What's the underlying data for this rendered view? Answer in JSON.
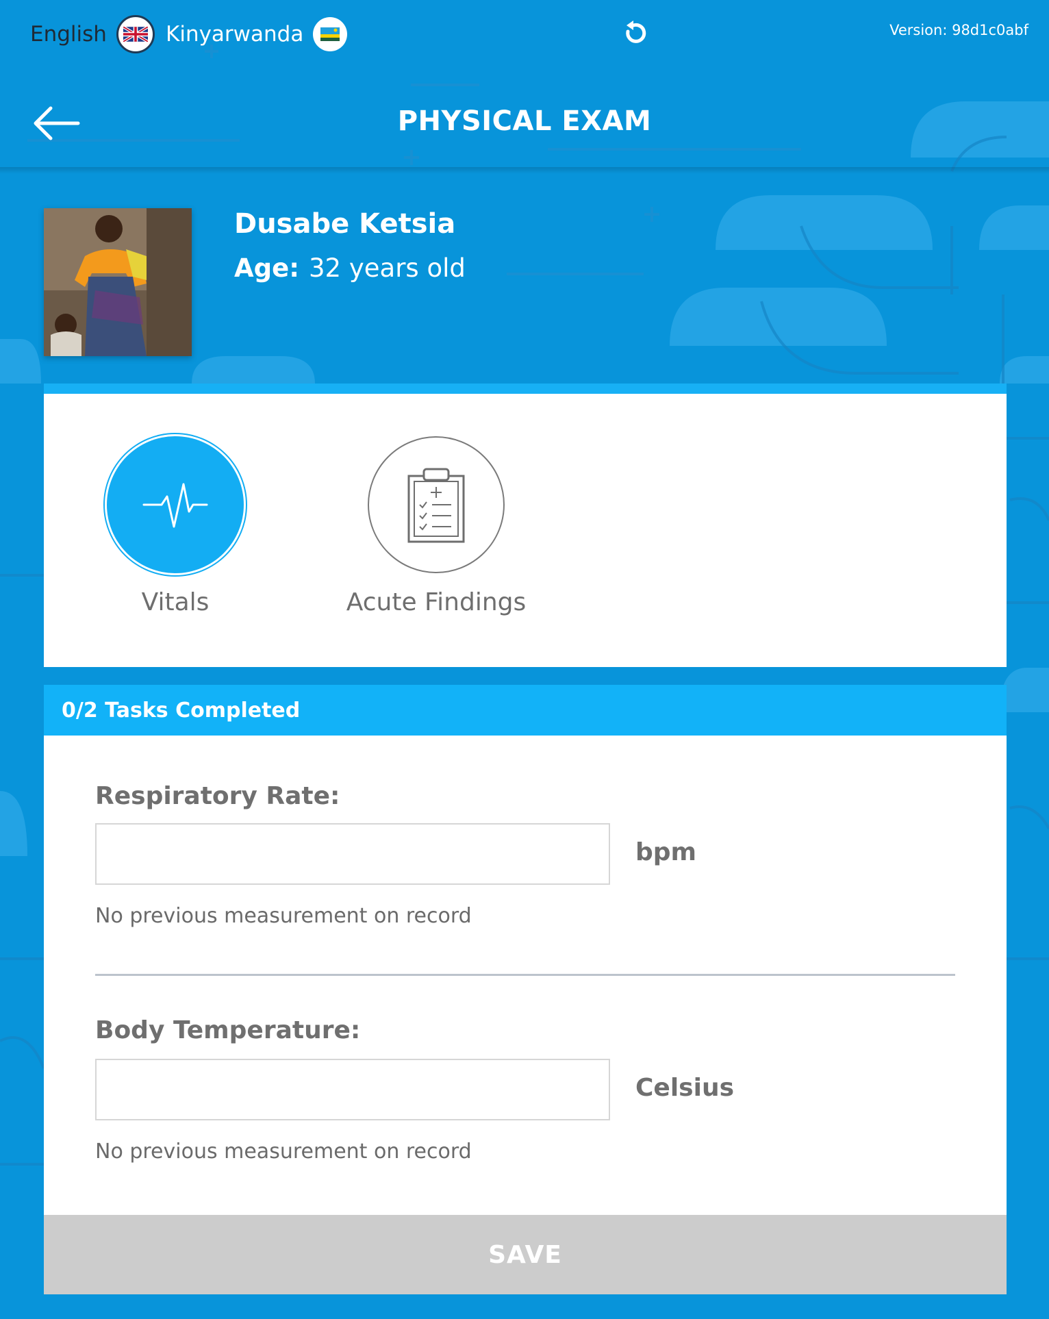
{
  "languages": [
    {
      "label": "English",
      "icon": "uk-flag-icon"
    },
    {
      "label": "Kinyarwanda",
      "icon": "rwanda-flag-icon"
    }
  ],
  "version": "Version: 98d1c0abf",
  "header": {
    "title": "PHYSICAL EXAM",
    "back_icon": "back-arrow-icon",
    "refresh_icon": "refresh-icon"
  },
  "patient": {
    "name": "Dusabe Ketsia",
    "age_label": "Age:",
    "age_value": "32 years old"
  },
  "tabs": [
    {
      "label": "Vitals",
      "icon": "heartbeat-icon",
      "active": true
    },
    {
      "label": "Acute Findings",
      "icon": "clipboard-checklist-icon",
      "active": false
    }
  ],
  "form": {
    "progress": "0/2 Tasks Completed",
    "fields": [
      {
        "label": "Respiratory Rate:",
        "value": "",
        "unit": "bpm",
        "note": "No previous measurement on record"
      },
      {
        "label": "Body Temperature:",
        "value": "",
        "unit": "Celsius",
        "note": "No previous measurement on record"
      }
    ],
    "save_label": "SAVE"
  },
  "colors": {
    "background": "#0894da",
    "accent": "#13adf3",
    "save_disabled": "#cccccc"
  }
}
